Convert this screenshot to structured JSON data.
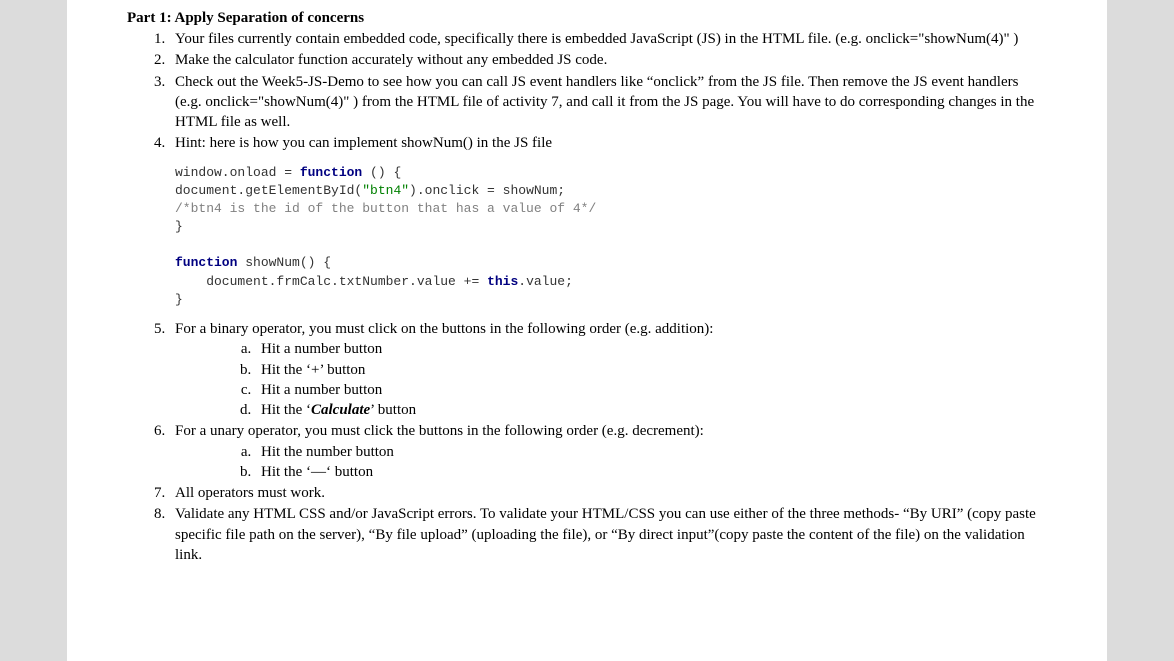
{
  "part_title": "Part 1: Apply Separation of concerns",
  "items": {
    "i1": "Your files currently contain embedded code, specifically there is embedded JavaScript (JS) in the HTML file. (e.g. onclick=\"showNum(4)\" )",
    "i2": "Make the calculator function accurately without any embedded JS code.",
    "i3": "Check out the Week5-JS-Demo to see how you can call JS event handlers like “onclick” from the JS file. Then remove the JS event handlers (e.g. onclick=\"showNum(4)\" ) from the HTML file of activity 7, and call it from the JS page. You will have to do corresponding changes in the HTML file as well.",
    "i4": "Hint: here is how you can implement showNum() in the JS file",
    "i5_lead": "For a binary operator, you must click on the buttons in the following order (e.g. addition):",
    "i5a": "Hit a number button",
    "i5b": "Hit the ‘+’ button",
    "i5c": "Hit a number button",
    "i5d_pre": "Hit the ‘",
    "i5d_bold": "Calculate",
    "i5d_post": "’ button",
    "i6_lead": "For a unary operator, you must click the buttons in the following order (e.g. decrement):",
    "i6a": "Hit the number button",
    "i6b": "Hit the ‘—‘ button",
    "i7": "All operators must work.",
    "i8": "Validate any HTML CSS and/or JavaScript errors. To validate your HTML/CSS you can use either of the three methods- “By URI” (copy paste specific file path on the server), “By file upload” (uploading the file), or “By direct input”(copy paste the content of the file) on the validation link."
  },
  "code": {
    "l1_a": "window.onload = ",
    "l1_b": "function",
    "l1_c": " () {",
    "l2_a": "document.getElementById(",
    "l2_b": "\"btn4\"",
    "l2_c": ").onclick = showNum;",
    "l3": "/*btn4 is the id of the button that has a value of 4*/",
    "l4": "}",
    "l6_a": "function",
    "l6_b": " showNum() {",
    "l7_a": "    document.frmCalc.txtNumber.value += ",
    "l7_b": "this",
    "l7_c": ".value;",
    "l8": "}"
  }
}
